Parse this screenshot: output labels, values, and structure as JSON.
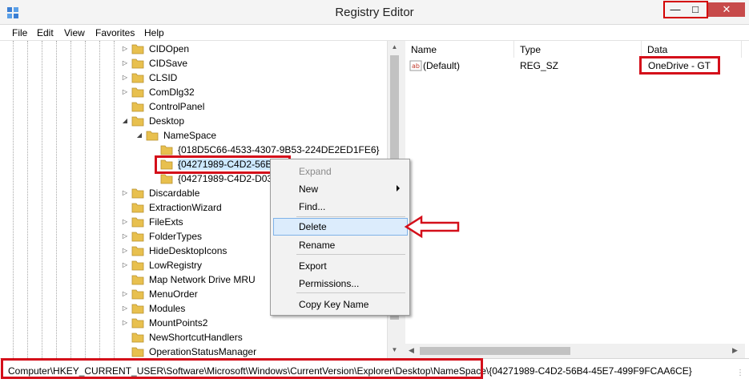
{
  "window": {
    "title": "Registry Editor",
    "min_glyph": "—",
    "max_glyph": "□",
    "close_glyph": "✕"
  },
  "menubar": [
    "File",
    "Edit",
    "View",
    "Favorites",
    "Help"
  ],
  "tree": {
    "items": [
      {
        "label": "CIDOpen",
        "expander": "▷"
      },
      {
        "label": "CIDSave",
        "expander": "▷"
      },
      {
        "label": "CLSID",
        "expander": "▷"
      },
      {
        "label": "ComDlg32",
        "expander": "▷"
      },
      {
        "label": "ControlPanel",
        "expander": ""
      },
      {
        "label": "Desktop",
        "expander": "◢"
      },
      {
        "label": "NameSpace",
        "expander": "◢"
      },
      {
        "label": "{018D5C66-4533-4307-9B53-224DE2ED1FE6}",
        "expander": ""
      },
      {
        "label": "{04271989-C4D2-56B4",
        "expander": ""
      },
      {
        "label": "{04271989-C4D2-D035",
        "expander": ""
      },
      {
        "label": "Discardable",
        "expander": "▷"
      },
      {
        "label": "ExtractionWizard",
        "expander": ""
      },
      {
        "label": "FileExts",
        "expander": "▷"
      },
      {
        "label": "FolderTypes",
        "expander": "▷"
      },
      {
        "label": "HideDesktopIcons",
        "expander": "▷"
      },
      {
        "label": "LowRegistry",
        "expander": "▷"
      },
      {
        "label": "Map Network Drive MRU",
        "expander": ""
      },
      {
        "label": "MenuOrder",
        "expander": "▷"
      },
      {
        "label": "Modules",
        "expander": "▷"
      },
      {
        "label": "MountPoints2",
        "expander": "▷"
      },
      {
        "label": "NewShortcutHandlers",
        "expander": ""
      },
      {
        "label": "OperationStatusManager",
        "expander": ""
      }
    ]
  },
  "list": {
    "columns": [
      "Name",
      "Type",
      "Data"
    ],
    "rows": [
      {
        "name": "(Default)",
        "type": "REG_SZ",
        "data": "OneDrive - GT",
        "icon": "string-value-icon"
      }
    ]
  },
  "context_menu": {
    "items": [
      {
        "label": "Expand",
        "state": "disabled"
      },
      {
        "label": "New",
        "submenu": true
      },
      {
        "label": "Find..."
      },
      {
        "label": "Delete",
        "state": "hover"
      },
      {
        "label": "Rename"
      },
      {
        "label": "Export"
      },
      {
        "label": "Permissions..."
      },
      {
        "label": "Copy Key Name"
      }
    ]
  },
  "statusbar": {
    "path": "Computer\\HKEY_CURRENT_USER\\Software\\Microsoft\\Windows\\CurrentVersion\\Explorer\\Desktop\\NameSpace\\{04271989-C4D2-56B4-45E7-499F9FCAA6CE}"
  },
  "colors": {
    "annotation_red": "#d40f1a",
    "folder_yellow": "#e8c04e",
    "selection": "#cce8ff",
    "menu_hover": "#dcecfc"
  }
}
